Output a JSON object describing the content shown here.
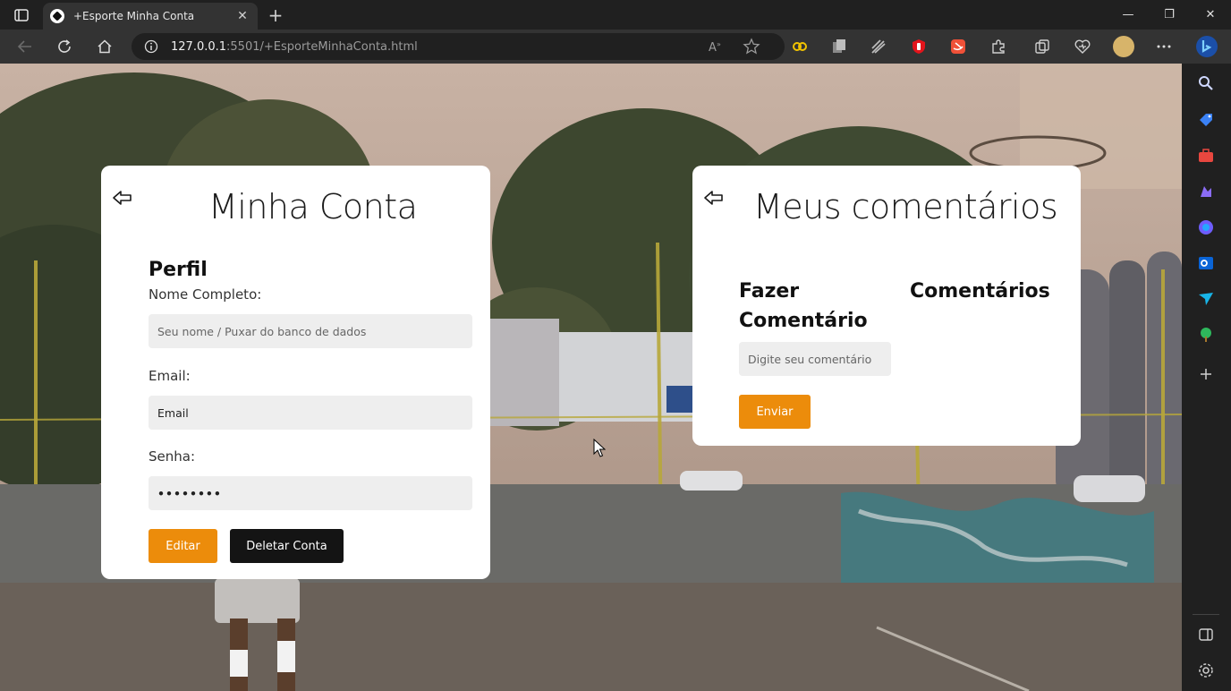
{
  "browser": {
    "tab_title": "+Esporte Minha Conta",
    "url_host": "127.0.0.1",
    "url_path": ":5501/+EsporteMinhaConta.html",
    "tab_close": "✕",
    "new_tab": "+",
    "window_controls": {
      "minimize": "—",
      "maximize": "❐",
      "close": "✕"
    }
  },
  "colors": {
    "accent": "#ec8c0b",
    "dark_button": "#141414",
    "card": "#ffffff",
    "input_bg": "#eeeeee"
  },
  "account_card": {
    "title": "Minha Conta",
    "section": "Perfil",
    "name_label": "Nome Completo:",
    "name_placeholder": "Seu nome / Puxar do banco de dados",
    "email_label": "Email:",
    "email_value": "Email",
    "password_label": "Senha:",
    "password_value": "••••••••",
    "edit_button": "Editar",
    "delete_button": "Deletar Conta"
  },
  "comments_card": {
    "title": "Meus comentários",
    "make_comment_heading": "Fazer Comentário",
    "comments_heading": "Comentários",
    "comment_placeholder": "Digite seu comentário",
    "send_button": "Enviar"
  }
}
